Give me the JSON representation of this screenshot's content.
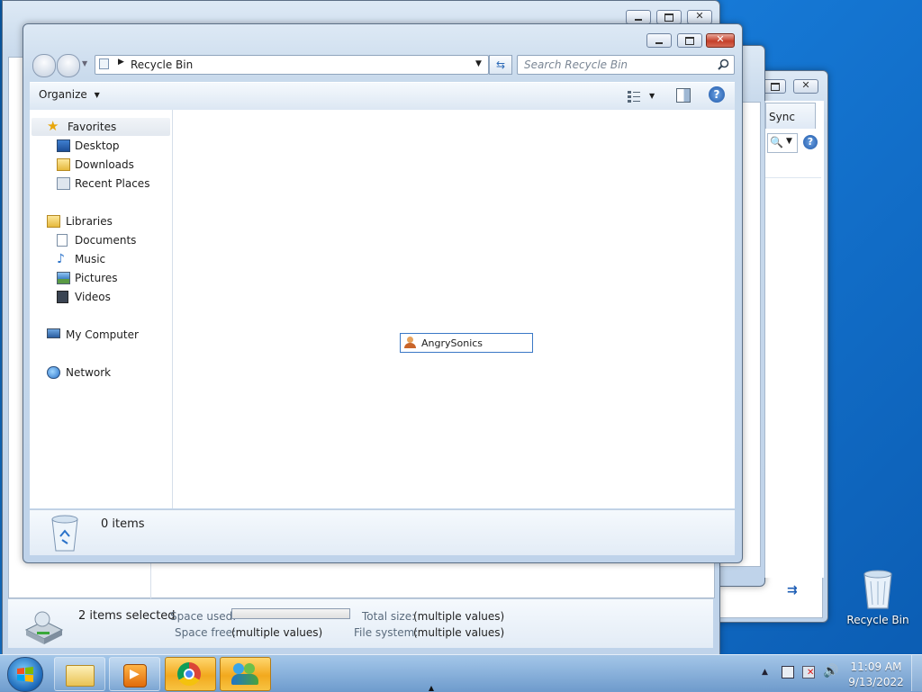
{
  "back_window": {
    "status": {
      "selected_text": "2 items selected",
      "space_used_label": "Space used:",
      "space_free_label": "Space free:",
      "space_free_value": "(multiple values)",
      "total_size_label": "Total size:",
      "total_size_value": "(multiple values)",
      "file_system_label": "File system:",
      "file_system_value": "(multiple values)",
      "space_used_fraction": 0
    }
  },
  "side_window": {
    "tab_label": "Sync"
  },
  "recycle_window": {
    "address": {
      "location": "Recycle Bin"
    },
    "search": {
      "placeholder": "Search Recycle Bin"
    },
    "toolbar": {
      "organize_label": "Organize"
    },
    "nav": {
      "favorites": {
        "label": "Favorites",
        "items": [
          {
            "label": "Desktop",
            "icon": "desktop-icon"
          },
          {
            "label": "Downloads",
            "icon": "downloads-folder-icon"
          },
          {
            "label": "Recent Places",
            "icon": "recent-places-icon"
          }
        ]
      },
      "libraries": {
        "label": "Libraries",
        "items": [
          {
            "label": "Documents",
            "icon": "documents-icon"
          },
          {
            "label": "Music",
            "icon": "music-icon"
          },
          {
            "label": "Pictures",
            "icon": "pictures-icon"
          },
          {
            "label": "Videos",
            "icon": "videos-icon"
          }
        ]
      },
      "computer": {
        "label": "My Computer"
      },
      "network": {
        "label": "Network"
      }
    },
    "drag_item": {
      "label": "AngrySonics"
    },
    "details": {
      "count_text": "0 items"
    }
  },
  "desktop": {
    "icons": [
      {
        "label": "Recycle Bin"
      }
    ]
  },
  "taskbar": {
    "clock_time": "11:09 AM",
    "clock_date": "9/13/2022",
    "buttons": [
      "start-orb",
      "windows-explorer",
      "media-player",
      "chrome",
      "messenger"
    ]
  },
  "colors": {
    "accent": "#2a72c9",
    "close_button": "#c5402a",
    "active_taskbar": "#f2a91e"
  }
}
